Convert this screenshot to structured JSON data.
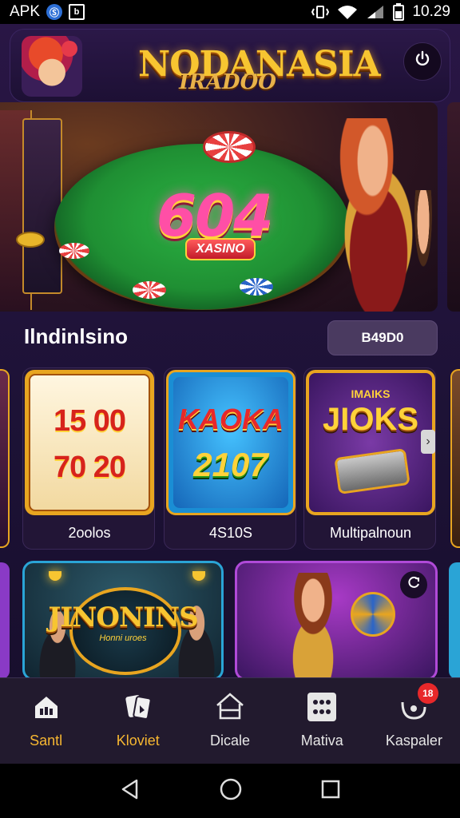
{
  "status_bar": {
    "app_label": "APK",
    "time": "10.29",
    "icons": [
      "circle-badge-icon",
      "square-badge-icon",
      "vibrate-icon",
      "wifi-icon",
      "signal-icon",
      "battery-icon"
    ]
  },
  "header": {
    "title": "NODANASIA",
    "subtitle": "IRADOO",
    "power_icon": "power-icon"
  },
  "hero": {
    "number": "604",
    "badge": "XASINO"
  },
  "section": {
    "title": "Ilndinlsino",
    "button_label": "B49D0"
  },
  "games": [
    {
      "label": "2oolos",
      "reels": [
        "15 00",
        "70 20"
      ]
    },
    {
      "label": "4S10S",
      "line1": "KAOKA",
      "line2": "2107"
    },
    {
      "label": "Multipalnoun",
      "top": "IMAIKS",
      "line1": "JIOKS"
    }
  ],
  "promos": [
    {
      "title": "JINONINS",
      "sub": "Honni uroes"
    },
    {
      "refresh_icon": "refresh-icon"
    }
  ],
  "bottom_nav": {
    "items": [
      {
        "label": "Santl",
        "icon": "home-icon",
        "active": true
      },
      {
        "label": "Kloviet",
        "icon": "cards-icon",
        "active": true
      },
      {
        "label": "Dicale",
        "icon": "house-outline-icon",
        "active": false
      },
      {
        "label": "Mativa",
        "icon": "grid-icon",
        "active": false
      },
      {
        "label": "Kaspaler",
        "icon": "wallet-icon",
        "active": false,
        "badge": "18"
      }
    ]
  },
  "colors": {
    "accent_gold": "#f7b731",
    "background": "#1d1236",
    "badge_red": "#e8282a"
  }
}
